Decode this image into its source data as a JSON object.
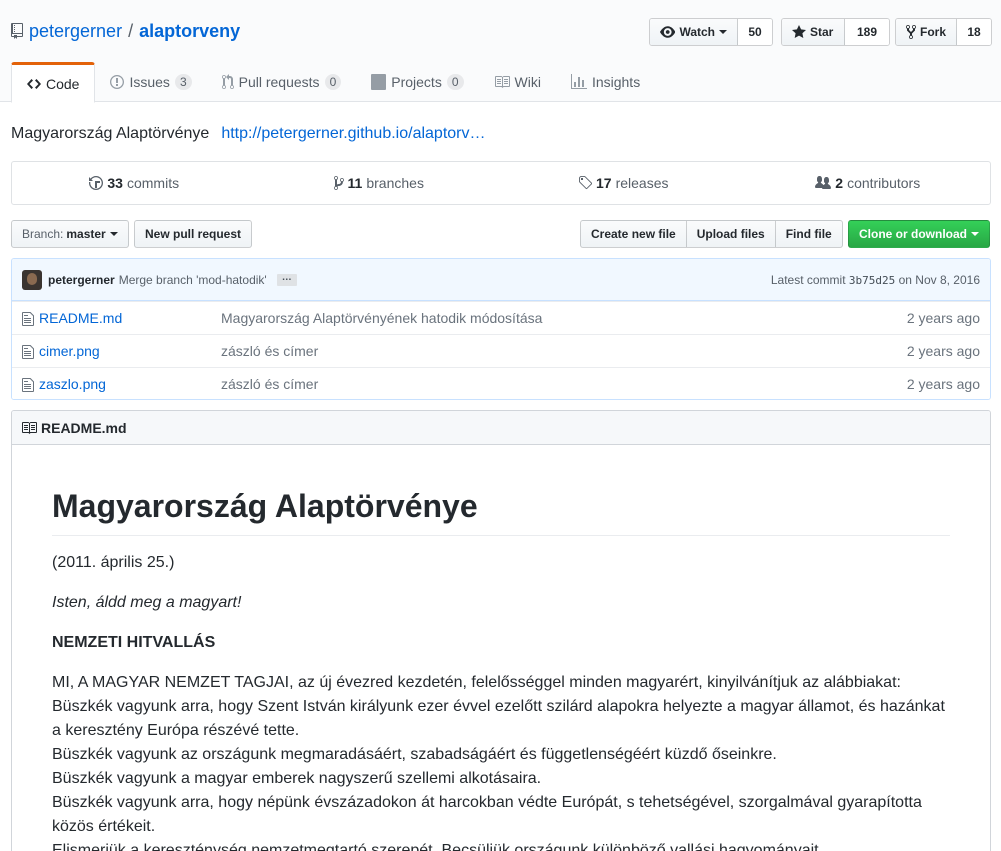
{
  "repo": {
    "owner": "petergerner",
    "separator": "/",
    "name": "alaptorveny"
  },
  "actions": {
    "watch": {
      "label": "Watch",
      "count": "50"
    },
    "star": {
      "label": "Star",
      "count": "189"
    },
    "fork": {
      "label": "Fork",
      "count": "18"
    }
  },
  "tabs": [
    {
      "label": "Code",
      "counter": ""
    },
    {
      "label": "Issues",
      "counter": "3"
    },
    {
      "label": "Pull requests",
      "counter": "0"
    },
    {
      "label": "Projects",
      "counter": "0"
    },
    {
      "label": "Wiki",
      "counter": ""
    },
    {
      "label": "Insights",
      "counter": ""
    }
  ],
  "description": {
    "text": "Magyarország Alaptörvénye",
    "link": "http://petergerner.github.io/alaptorv…"
  },
  "summary": {
    "commits": {
      "count": "33",
      "label": "commits"
    },
    "branches": {
      "count": "11",
      "label": "branches"
    },
    "releases": {
      "count": "17",
      "label": "releases"
    },
    "contributors": {
      "count": "2",
      "label": "contributors"
    }
  },
  "filenav": {
    "branch_prefix": "Branch:",
    "branch": "master",
    "new_pr": "New pull request",
    "create_file": "Create new file",
    "upload": "Upload files",
    "find": "Find file",
    "clone": "Clone or download"
  },
  "commit": {
    "author": "petergerner",
    "message": "Merge branch 'mod-hatodik'",
    "ellipsis": "…",
    "latest_label": "Latest commit",
    "sha": "3b75d25",
    "date": "on Nov 8, 2016"
  },
  "files": [
    {
      "name": "README.md",
      "message": "Magyarország Alaptörvényének hatodik módosítása",
      "age": "2 years ago"
    },
    {
      "name": "cimer.png",
      "message": "zászló és címer",
      "age": "2 years ago"
    },
    {
      "name": "zaszlo.png",
      "message": "zászló és címer",
      "age": "2 years ago"
    }
  ],
  "readme": {
    "header": "README.md",
    "title": "Magyarország Alaptörvénye",
    "date": "(2011. április 25.)",
    "motto": "Isten, áldd meg a magyart!",
    "section": "NEMZETI HITVALLÁS",
    "lines": [
      "MI, A MAGYAR NEMZET TAGJAI, az új évezred kezdetén, felelősséggel minden magyarért, kinyilvánítjuk az alábbiakat:",
      "Büszkék vagyunk arra, hogy Szent István királyunk ezer évvel ezelőtt szilárd alapokra helyezte a magyar államot, és hazánkat a keresztény Európa részévé tette.",
      "Büszkék vagyunk az országunk megmaradásáért, szabadságáért és függetlenségéért küzdő őseinkre.",
      "Büszkék vagyunk a magyar emberek nagyszerű szellemi alkotásaira.",
      "Büszkék vagyunk arra, hogy népünk évszázadokon át harcokban védte Európát, s tehetségével, szorgalmával gyarapította közös értékeit.",
      "Elismerjük a kereszténység nemzetmegtartó szerepét. Becsüljük országunk különböző vallási hagyományait."
    ]
  },
  "colors": {
    "link": "#0366d6",
    "tab_accent": "#e36209",
    "green_button": "#28a745"
  }
}
